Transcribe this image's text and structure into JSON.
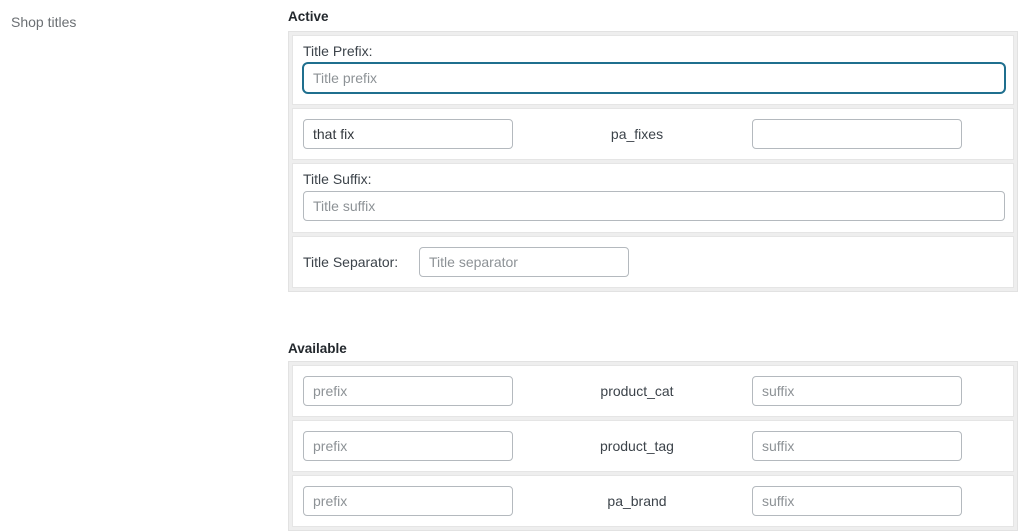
{
  "form_row": {
    "label": "Shop titles"
  },
  "active": {
    "heading": "Active",
    "title_prefix": {
      "label": "Title Prefix:",
      "placeholder": "Title prefix",
      "value": ""
    },
    "term_rows": [
      {
        "term": "pa_fixes",
        "prefix_value": "that fix",
        "prefix_placeholder": "",
        "suffix_value": "",
        "suffix_placeholder": ""
      }
    ],
    "title_suffix": {
      "label": "Title Suffix:",
      "placeholder": "Title suffix",
      "value": ""
    },
    "title_separator": {
      "label": "Title Separator:",
      "placeholder": "Title separator",
      "value": ""
    }
  },
  "available": {
    "heading": "Available",
    "rows": [
      {
        "term": "product_cat",
        "prefix_placeholder": "prefix",
        "prefix_value": "",
        "suffix_placeholder": "suffix",
        "suffix_value": ""
      },
      {
        "term": "product_tag",
        "prefix_placeholder": "prefix",
        "prefix_value": "",
        "suffix_placeholder": "suffix",
        "suffix_value": ""
      },
      {
        "term": "pa_brand",
        "prefix_placeholder": "prefix",
        "prefix_value": "",
        "suffix_placeholder": "suffix",
        "suffix_value": ""
      }
    ]
  },
  "colors": {
    "focus_border": "#1f6f8e",
    "input_border": "#b4b9be",
    "card_background": "#ffffff",
    "group_background": "#eeeeee",
    "label_text": "#6b6f73",
    "heading_text": "#23282d"
  }
}
